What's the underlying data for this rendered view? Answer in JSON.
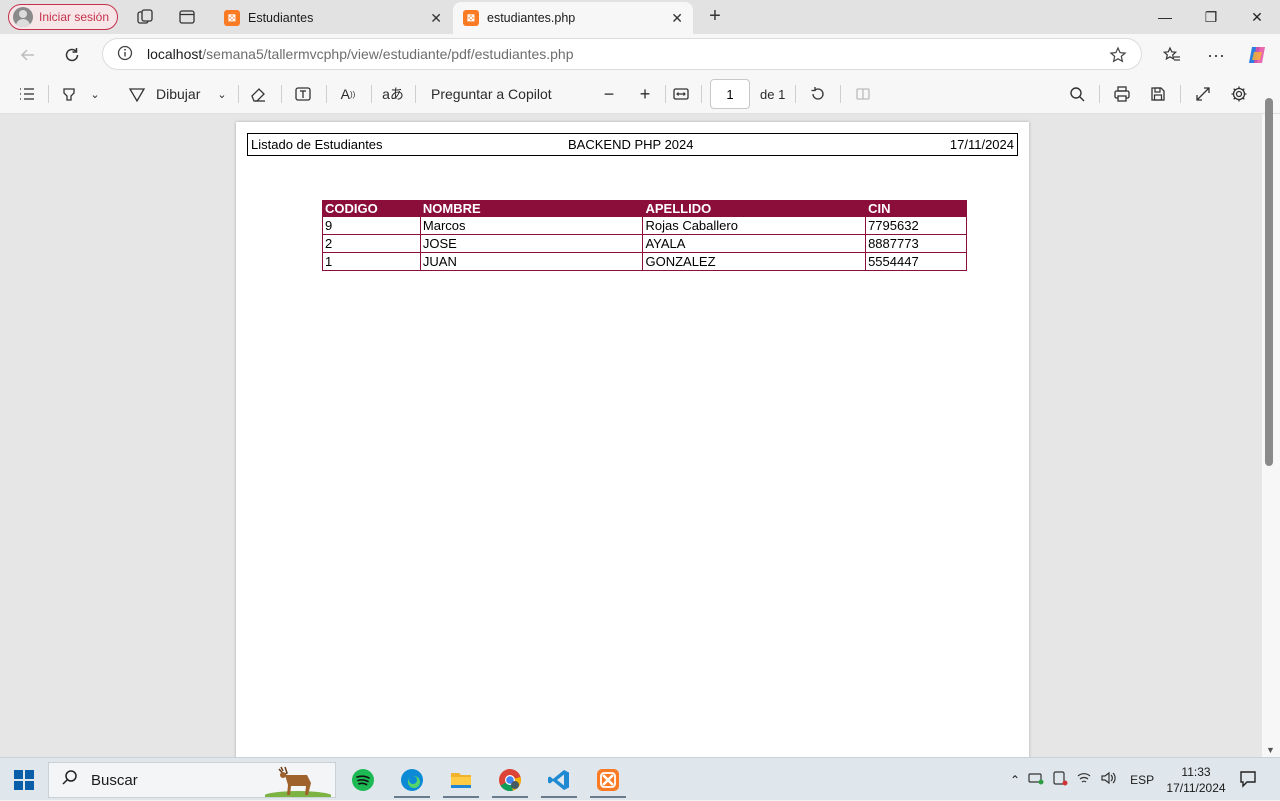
{
  "browser": {
    "profile_label": "Iniciar sesión",
    "tabs": [
      {
        "title": "Estudiantes",
        "favicon": "xampp-icon"
      },
      {
        "title": "estudiantes.php",
        "favicon": "xampp-icon"
      }
    ],
    "url": {
      "host": "localhost",
      "path": "/semana5/tallermvcphp/view/estudiante/pdf/estudiantes.php"
    }
  },
  "pdf_toolbar": {
    "draw_label": "Dibujar",
    "copilot_label": "Preguntar a Copilot",
    "page_value": "1",
    "page_total": "de 1"
  },
  "document": {
    "header": {
      "left": "Listado de Estudiantes",
      "center": "BACKEND PHP 2024",
      "right": "17/11/2024"
    },
    "table": {
      "columns": [
        "CODIGO",
        "NOMBRE",
        "APELLIDO",
        "CIN"
      ],
      "rows": [
        [
          "9",
          "Marcos",
          "Rojas Caballero",
          "7795632"
        ],
        [
          "2",
          "JOSE",
          "AYALA",
          "8887773"
        ],
        [
          "1",
          "JUAN",
          "GONZALEZ",
          "5554447"
        ]
      ],
      "header_color": "#8b0d3a"
    }
  },
  "taskbar": {
    "search_label": "Buscar",
    "language": "ESP",
    "time": "11:33",
    "date": "17/11/2024"
  }
}
